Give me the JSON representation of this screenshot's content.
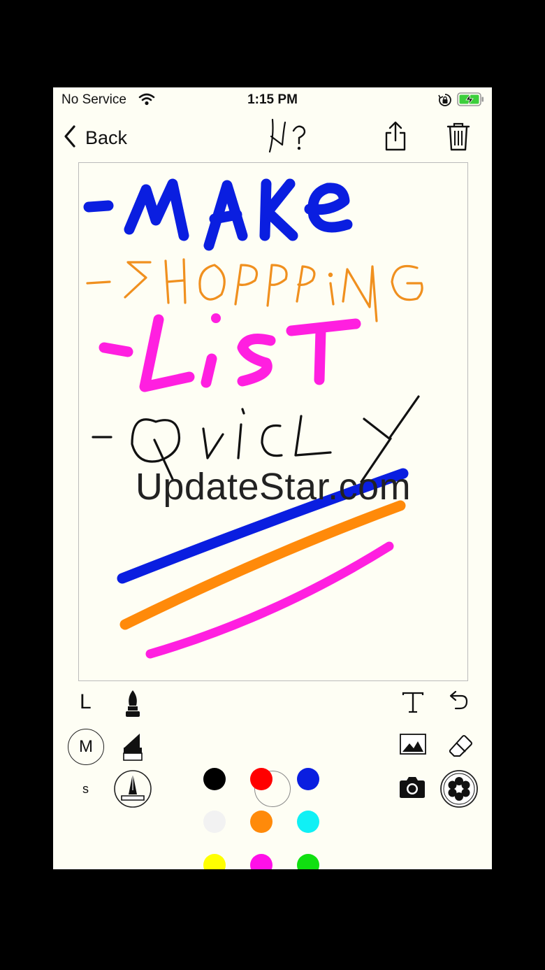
{
  "status_bar": {
    "carrier": "No Service",
    "time": "1:15 PM"
  },
  "nav": {
    "back_label": "Back",
    "help_icon": "help-scribble-icon",
    "share_icon": "share-icon",
    "trash_icon": "trash-icon"
  },
  "canvas": {
    "watermark": "UpdateStar.com",
    "handwriting_lines": [
      "-MAKE",
      "-SHOPPING",
      "-LIST",
      "-QVICLY"
    ],
    "stroke_colors": [
      "#0a1ee0",
      "#ff8a1a",
      "#ff1fe0",
      "#111111"
    ]
  },
  "toolbar": {
    "sizes": {
      "large": "L",
      "medium": "M",
      "small": "s",
      "selected": "M"
    },
    "brushes": [
      "calligraphy-pen-icon",
      "marker-icon",
      "fountain-pen-icon"
    ],
    "selected_brush": "fountain-pen-icon",
    "colors": [
      [
        "#000000",
        "#ff0000",
        "#0a1ee0"
      ],
      [
        "#f2f2f2",
        "#ff8a0a",
        "#10f0f5"
      ],
      [
        "#ffff00",
        "#ff10e8",
        "#10e010"
      ]
    ],
    "selected_color": "#ff10e8",
    "actions": [
      "text-tool-icon",
      "undo-icon",
      "image-icon",
      "eraser-icon",
      "camera-icon",
      "stamp-flower-icon"
    ]
  }
}
